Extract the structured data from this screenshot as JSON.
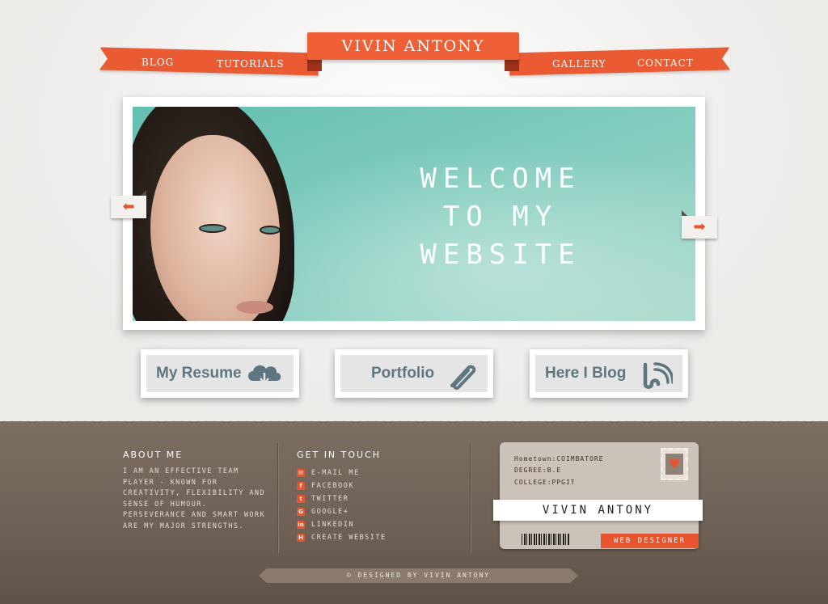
{
  "site_title": "VIVIN ANTONY",
  "nav": [
    {
      "label": "BLOG"
    },
    {
      "label": "TUTORIALS"
    },
    {
      "label": "GALLERY"
    },
    {
      "label": "CONTACT"
    }
  ],
  "hero": {
    "lines": [
      "WELCOME",
      "TO MY",
      "WEBSITE"
    ],
    "prev_icon": "arrow-left-icon",
    "next_icon": "arrow-right-icon"
  },
  "features": [
    {
      "label": "My Resume",
      "icon": "cloud-download-icon"
    },
    {
      "label": "Portfolio",
      "icon": "paperclip-icon"
    },
    {
      "label": "Here I Blog",
      "icon": "blogger-rss-icon"
    }
  ],
  "about": {
    "title": "ABOUT ME",
    "text": "I AM AN EFFECTIVE TEAM PLAYER - KNOWN FOR CREATIVITY, FLEXIBILITY AND SENSE OF HUMOUR. PERSEVERANCE AND SMART WORK ARE MY MAJOR STRENGTHS."
  },
  "contact": {
    "title": "GET IN TOUCH",
    "links": [
      {
        "label": "E-MAIL ME",
        "icon": "mail-icon",
        "glyph": "✉"
      },
      {
        "label": "FACEBOOK",
        "icon": "facebook-icon",
        "glyph": "f"
      },
      {
        "label": "TWITTER",
        "icon": "twitter-icon",
        "glyph": "t"
      },
      {
        "label": "GOOGLE+",
        "icon": "google-plus-icon",
        "glyph": "G"
      },
      {
        "label": "LINKEDIN",
        "icon": "linkedin-icon",
        "glyph": "in"
      },
      {
        "label": "CREATE WEBSITE",
        "icon": "website-icon",
        "glyph": "H"
      }
    ]
  },
  "id_card": {
    "hometown": "Hometown:COIMBATORE",
    "degree": "DEGREE:B.E",
    "college": "COLLEGE:PPGIT",
    "name": "VIVIN ANTONY",
    "role": "WEB DESIGNER",
    "stamp_icon": "heart-icon"
  },
  "footer": {
    "copyright": "©  DESIGNED BY VIVIN ANTONY"
  },
  "colors": {
    "accent": "#e8542d",
    "footer_bg": "#75675b",
    "teal": "#6dc3b4"
  }
}
